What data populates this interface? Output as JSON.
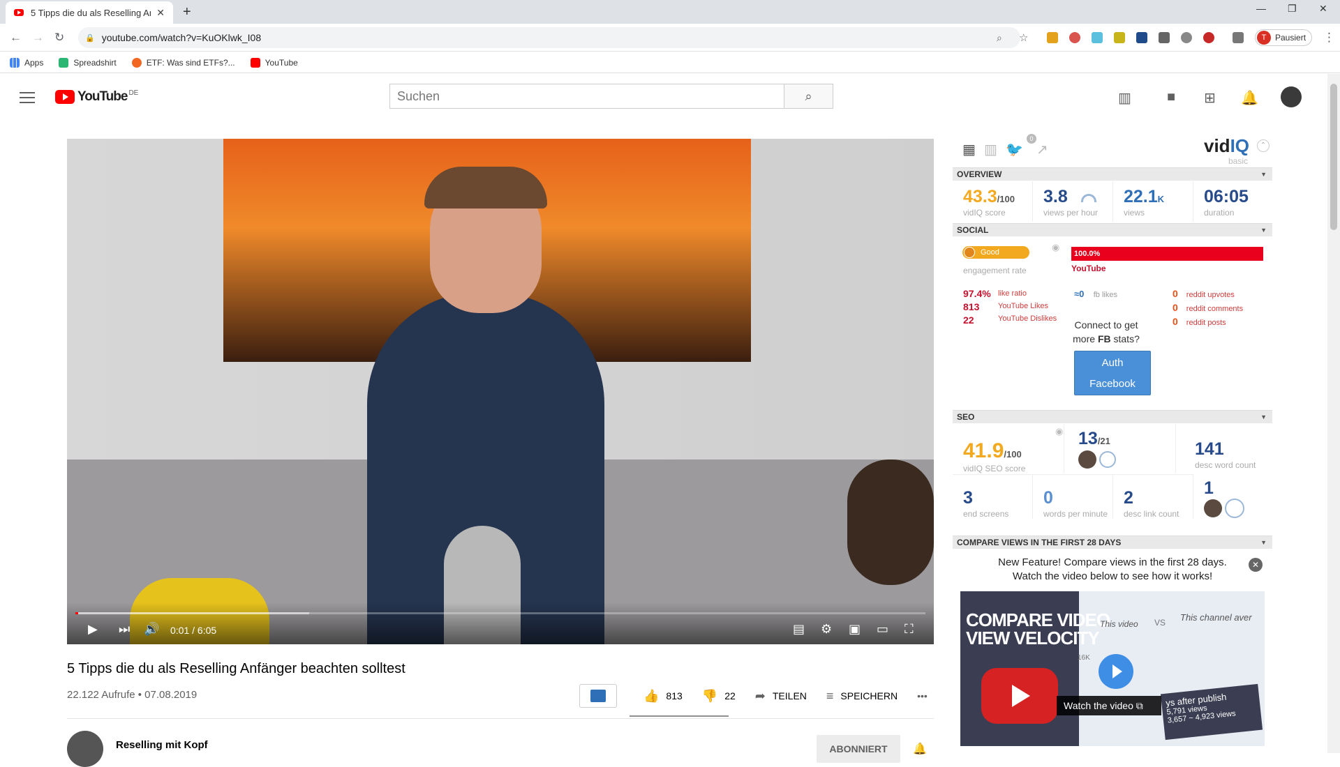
{
  "browser": {
    "tab_title": "5 Tipps die du als Reselling Anfä",
    "url": "youtube.com/watch?v=KuOKlwk_I08",
    "profile_initial": "T",
    "profile_label": "Pausiert",
    "bookmarks": [
      "Apps",
      "Spreadshirt",
      "ETF: Was sind ETFs?...",
      "YouTube"
    ]
  },
  "youtube": {
    "logo_word": "YouTube",
    "region": "DE",
    "search_placeholder": "Suchen"
  },
  "player": {
    "time": "0:01 / 6:05",
    "played_fraction": 0.003,
    "loaded_fraction": 0.275
  },
  "video": {
    "title": "5 Tipps die du als Reselling Anfänger beachten solltest",
    "meta": "22.122 Aufrufe • 07.08.2019",
    "likes": "813",
    "dislikes": "22",
    "share_label": "TEILEN",
    "save_label": "SPEICHERN",
    "more_label": "•••",
    "channel_name": "Reselling mit Kopf",
    "subscribe_label": "ABONNIERT"
  },
  "vidiq": {
    "logo_vid": "vid",
    "logo_iq": "IQ",
    "plan": "basic",
    "notification_count": "0",
    "overview": {
      "header": "OVERVIEW",
      "score": "43.3",
      "score_unit": "/100",
      "score_label": "vidIQ score",
      "vph": "3.8",
      "vph_label": "views per hour",
      "views": "22.1",
      "views_unit": "K",
      "views_label": "views",
      "duration": "06:05",
      "duration_label": "duration"
    },
    "social": {
      "header": "SOCIAL",
      "engagement": "Good",
      "engagement_label": "engagement rate",
      "yt_share": "100.0%",
      "yt_label": "YouTube",
      "like_ratio": "97.4%",
      "like_ratio_label": "like ratio",
      "yt_likes": "813",
      "yt_likes_label": "YouTube Likes",
      "yt_dislikes": "22",
      "yt_dislikes_label": "YouTube Dislikes",
      "fb_likes": "≈0",
      "fb_likes_label": "fb likes",
      "reddit_upvotes": "0",
      "reddit_upvotes_label": "reddit upvotes",
      "reddit_comments": "0",
      "reddit_comments_label": "reddit comments",
      "reddit_posts": "0",
      "reddit_posts_label": "reddit posts",
      "fb_connect_1": "Connect to get",
      "fb_connect_2": "more",
      "fb_connect_bold": "FB",
      "fb_connect_3": "stats?",
      "auth_1": "Auth",
      "auth_2": "Facebook"
    },
    "seo": {
      "header": "SEO",
      "seo_score": "41.9",
      "seo_unit": "/100",
      "seo_label": "vidIQ SEO score",
      "tags": "13",
      "tags_unit": "/21",
      "desc_words": "141",
      "desc_words_label": "desc word count",
      "end_screens": "3",
      "end_screens_label": "end screens",
      "wpm": "0",
      "wpm_label": "words per minute",
      "desc_links": "2",
      "desc_links_label": "desc link count",
      "cards": "1"
    },
    "compare": {
      "header": "COMPARE VIEWS IN THE FIRST 28 DAYS",
      "text_1": "New Feature! Compare views in the first 28 days.",
      "text_2": "Watch the video below to see how it works!",
      "thumb_title_1": "COMPARE VIDEO",
      "thumb_title_2": "VIEW VELOCITY",
      "this_video": "This video",
      "vs": "VS",
      "this_channel": "This channel aver",
      "watch": "Watch the video",
      "axis_16k": "16K",
      "days_1": "ys after publish",
      "days_2": "5,791 views",
      "days_3": "3,657 ~ 4,923 views"
    }
  }
}
